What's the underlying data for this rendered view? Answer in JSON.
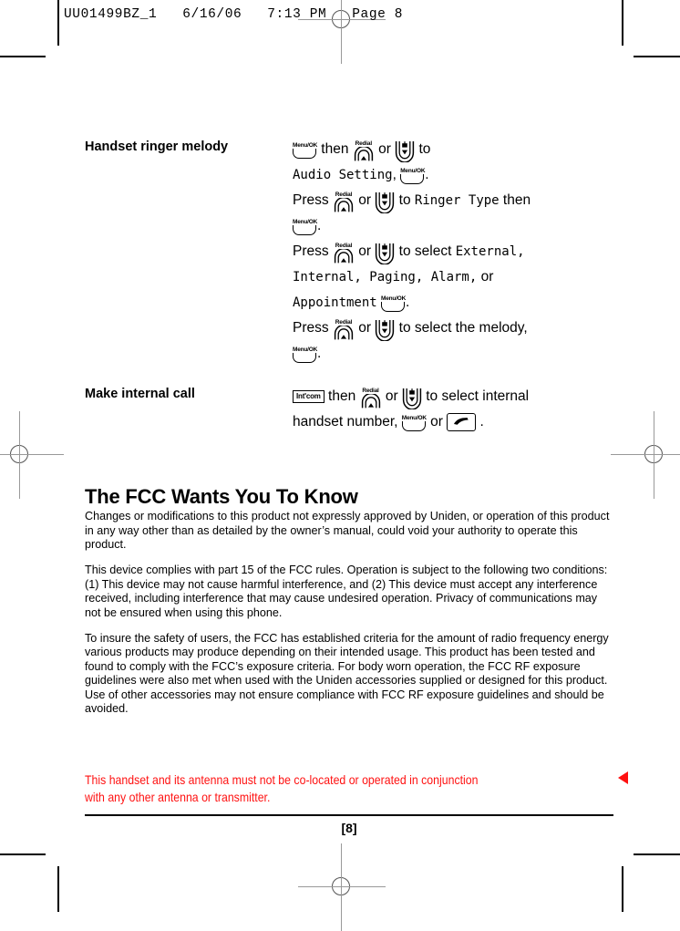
{
  "film_header": {
    "job_id": "UU01499BZ_1",
    "date": "6/16/06",
    "time": "7:13 PM",
    "page_label": "Page 8",
    "text": "UU01499BZ_1   6/16/06   7:13 PM   Page 8"
  },
  "icons": {
    "menu_ok": {
      "name": "menu-ok-key",
      "label": "Menu/OK"
    },
    "redial_up": {
      "name": "redial-up-key",
      "label": "Redial"
    },
    "phonebook_down": {
      "name": "phonebook-down-key",
      "label": ""
    },
    "intcom": {
      "name": "intcom-key",
      "label": "Int'com"
    },
    "talk": {
      "name": "talk-key",
      "label": ""
    }
  },
  "sections": [
    {
      "id": "handset-ringer-melody",
      "label": "Handset ringer melody",
      "lines": [
        [
          {
            "type": "key",
            "key": "menu_ok"
          },
          {
            "type": "text",
            "text": " then "
          },
          {
            "type": "key",
            "key": "redial_up"
          },
          {
            "type": "text",
            "text": " or "
          },
          {
            "type": "key",
            "key": "phonebook_down"
          },
          {
            "type": "text",
            "text": " to"
          }
        ],
        [
          {
            "type": "lcd",
            "text": "Audio Setting"
          },
          {
            "type": "text",
            "text": ", "
          },
          {
            "type": "key",
            "key": "menu_ok"
          },
          {
            "type": "text",
            "text": "."
          }
        ],
        [
          {
            "type": "text",
            "text": "Press "
          },
          {
            "type": "key",
            "key": "redial_up"
          },
          {
            "type": "text",
            "text": " or "
          },
          {
            "type": "key",
            "key": "phonebook_down"
          },
          {
            "type": "text",
            "text": " to "
          },
          {
            "type": "lcd",
            "text": "Ringer Type"
          },
          {
            "type": "text",
            "text": " then"
          }
        ],
        [
          {
            "type": "key",
            "key": "menu_ok"
          },
          {
            "type": "text",
            "text": "."
          }
        ],
        [
          {
            "type": "text",
            "text": "Press "
          },
          {
            "type": "key",
            "key": "redial_up"
          },
          {
            "type": "text",
            "text": " or "
          },
          {
            "type": "key",
            "key": "phonebook_down"
          },
          {
            "type": "text",
            "text": " to select "
          },
          {
            "type": "lcd",
            "text": "External,"
          }
        ],
        [
          {
            "type": "lcd",
            "text": "Internal, Paging, Alarm,"
          },
          {
            "type": "text",
            "text": " or"
          }
        ],
        [
          {
            "type": "lcd",
            "text": "Appointment"
          },
          {
            "type": "text",
            "text": " "
          },
          {
            "type": "key",
            "key": "menu_ok"
          },
          {
            "type": "text",
            "text": "."
          }
        ],
        [
          {
            "type": "text",
            "text": "Press "
          },
          {
            "type": "key",
            "key": "redial_up"
          },
          {
            "type": "text",
            "text": " or "
          },
          {
            "type": "key",
            "key": "phonebook_down"
          },
          {
            "type": "text",
            "text": " to select the melody,"
          }
        ],
        [
          {
            "type": "key",
            "key": "menu_ok"
          },
          {
            "type": "text",
            "text": "."
          }
        ]
      ]
    },
    {
      "id": "make-internal-call",
      "label": "Make internal call",
      "lines": [
        [
          {
            "type": "key",
            "key": "intcom"
          },
          {
            "type": "text",
            "text": "  then "
          },
          {
            "type": "key",
            "key": "redial_up"
          },
          {
            "type": "text",
            "text": " or "
          },
          {
            "type": "key",
            "key": "phonebook_down"
          },
          {
            "type": "text",
            "text": " to select internal"
          }
        ],
        [
          {
            "type": "text",
            "text": "handset number,  "
          },
          {
            "type": "key",
            "key": "menu_ok"
          },
          {
            "type": "text",
            "text": " or "
          },
          {
            "type": "key",
            "key": "talk"
          },
          {
            "type": "text",
            "text": " ."
          }
        ]
      ]
    }
  ],
  "fcc": {
    "title": "The FCC Wants You To Know",
    "paragraphs": [
      "Changes or modifications to this product not expressly approved by Uniden, or operation of this product in any way other than as detailed by the owner’s manual, could void your authority to operate this product.",
      "This device complies with part 15 of the FCC rules. Operation is subject to the following two conditions: (1) This device may not cause harmful interference, and (2) This device must accept any interference received, including interference that may cause undesired operation. Privacy of communications may not be ensured when using this phone.",
      "To insure the safety of users, the FCC has established criteria for the amount of radio frequency energy various products may produce depending on their intended usage. This product has been tested and found to comply with the FCC’s exposure criteria. For body worn operation, the FCC RF exposure guidelines were also met when used with the Uniden accessories supplied or designed for this product. Use of other accessories may not ensure compliance with FCC RF exposure guidelines and should be avoided."
    ],
    "warning_lines": [
      "This handset and its antenna must not be co-located or operated in conjunction",
      "with any other antenna or transmitter."
    ],
    "warning_color": "#ff1111"
  },
  "footer": {
    "page_number": "[8]"
  }
}
